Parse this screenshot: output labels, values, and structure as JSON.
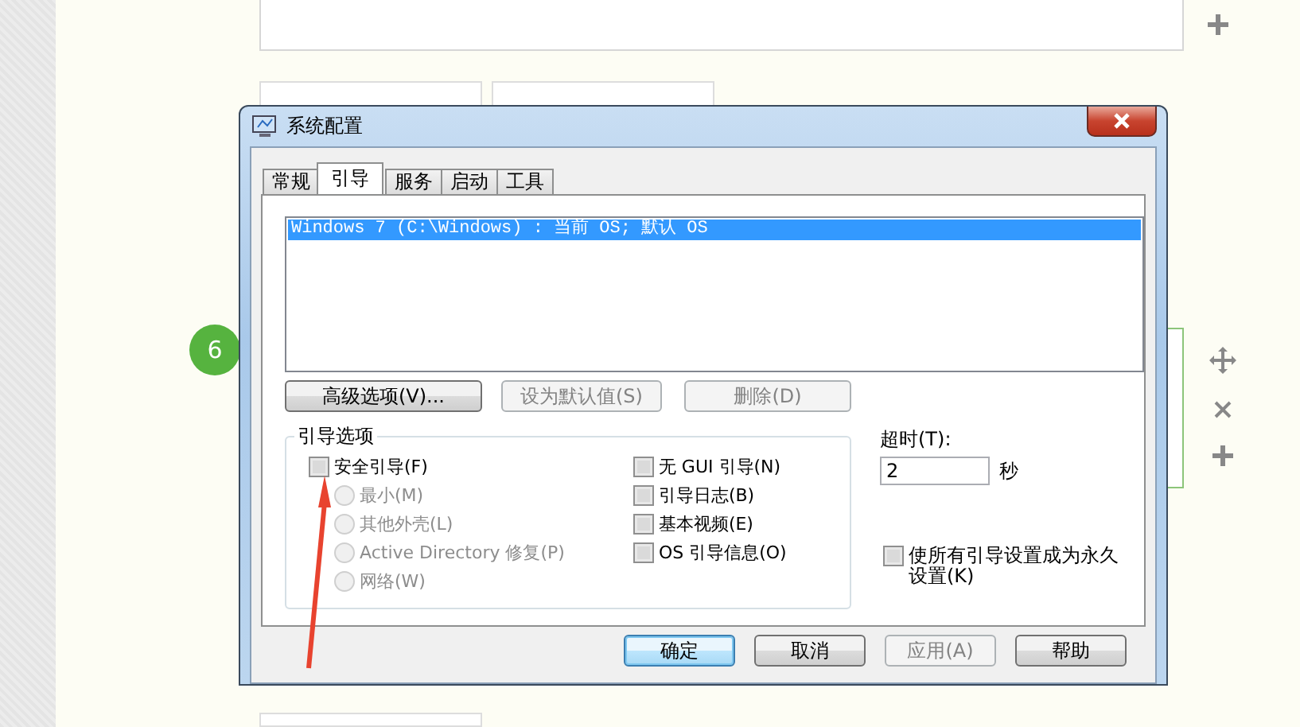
{
  "step_number": "6",
  "dialog": {
    "title": "系统配置",
    "tabs": [
      {
        "label": "常规",
        "selected": false
      },
      {
        "label": "引导",
        "selected": true
      },
      {
        "label": "服务",
        "selected": false
      },
      {
        "label": "启动",
        "selected": false
      },
      {
        "label": "工具",
        "selected": false
      }
    ],
    "boot_list": [
      {
        "text": "Windows 7 (C:\\Windows) : 当前 OS; 默认 OS",
        "selected": true
      }
    ],
    "list_buttons": [
      {
        "label": "高级选项(V)...",
        "disabled": false
      },
      {
        "label": "设为默认值(S)",
        "disabled": true
      },
      {
        "label": "删除(D)",
        "disabled": true
      }
    ],
    "boot_options": {
      "title": "引导选项",
      "left": [
        {
          "kind": "checkbox",
          "label": "安全引导(F)",
          "checked": false,
          "disabled": false
        },
        {
          "kind": "radio",
          "label": "最小(M)",
          "selected": false,
          "disabled": true
        },
        {
          "kind": "radio",
          "label": "其他外壳(L)",
          "selected": false,
          "disabled": true
        },
        {
          "kind": "radio",
          "label": "Active Directory 修复(P)",
          "selected": false,
          "disabled": true
        },
        {
          "kind": "radio",
          "label": "网络(W)",
          "selected": false,
          "disabled": true
        }
      ],
      "right": [
        {
          "kind": "checkbox",
          "label": "无 GUI 引导(N)",
          "checked": false,
          "disabled": false
        },
        {
          "kind": "checkbox",
          "label": "引导日志(B)",
          "checked": false,
          "disabled": false
        },
        {
          "kind": "checkbox",
          "label": "基本视频(E)",
          "checked": false,
          "disabled": false
        },
        {
          "kind": "checkbox",
          "label": "OS 引导信息(O)",
          "checked": false,
          "disabled": false
        }
      ]
    },
    "timeout": {
      "label": "超时(T):",
      "value": "2",
      "unit": "秒"
    },
    "permanent": {
      "label": "使所有引导设置成为永久设置(K)",
      "checked": false
    },
    "buttons": [
      {
        "label": "确定",
        "disabled": false,
        "default": true
      },
      {
        "label": "取消",
        "disabled": false,
        "default": false
      },
      {
        "label": "应用(A)",
        "disabled": true,
        "default": false
      },
      {
        "label": "帮助",
        "disabled": false,
        "default": false
      }
    ]
  }
}
